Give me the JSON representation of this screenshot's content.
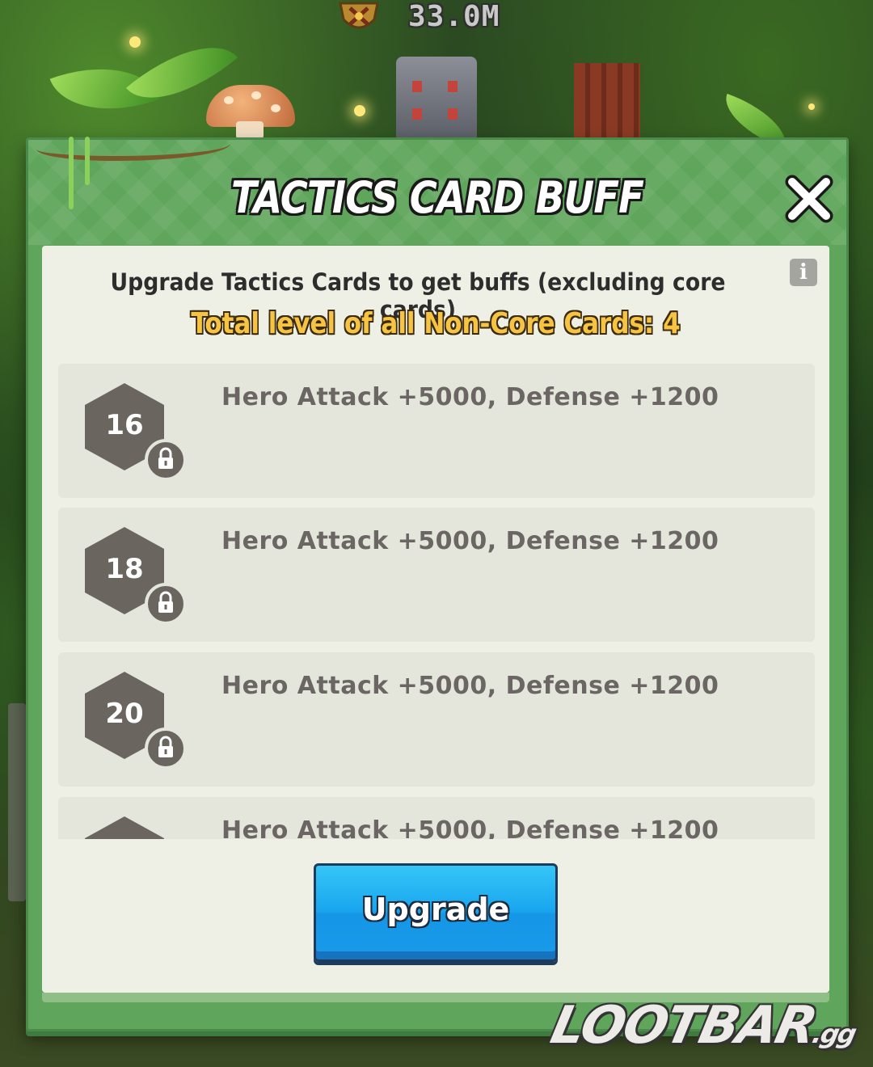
{
  "hud": {
    "power_value": "33.0M"
  },
  "dialog": {
    "title": "TACTICS CARD BUFF",
    "subtitle": "Upgrade Tactics Cards to get buffs (excluding core cards)",
    "total_level_text": "Total level of all Non-Core Cards: 4",
    "buffs": [
      {
        "level": "16",
        "text": "Hero Attack +5000, Defense +1200",
        "locked": true
      },
      {
        "level": "18",
        "text": "Hero Attack +5000, Defense +1200",
        "locked": true
      },
      {
        "level": "20",
        "text": "Hero Attack +5000, Defense +1200",
        "locked": true
      },
      {
        "level": "",
        "text": "Hero Attack +5000, Defense +1200",
        "locked": true
      }
    ],
    "upgrade_label": "Upgrade"
  },
  "watermark": {
    "brand": "LOOTBAR",
    "suffix": ".gg"
  },
  "colors": {
    "dialog_green": "#5fa55b",
    "panel_bg": "#eef0e5",
    "row_bg": "#e4e6dc",
    "badge_grey": "#6b6560",
    "gold_text": "#f6c343",
    "button_blue": "#19a6ef"
  },
  "icons": [
    "power-emblem-icon",
    "close-icon",
    "info-icon",
    "lock-icon"
  ]
}
